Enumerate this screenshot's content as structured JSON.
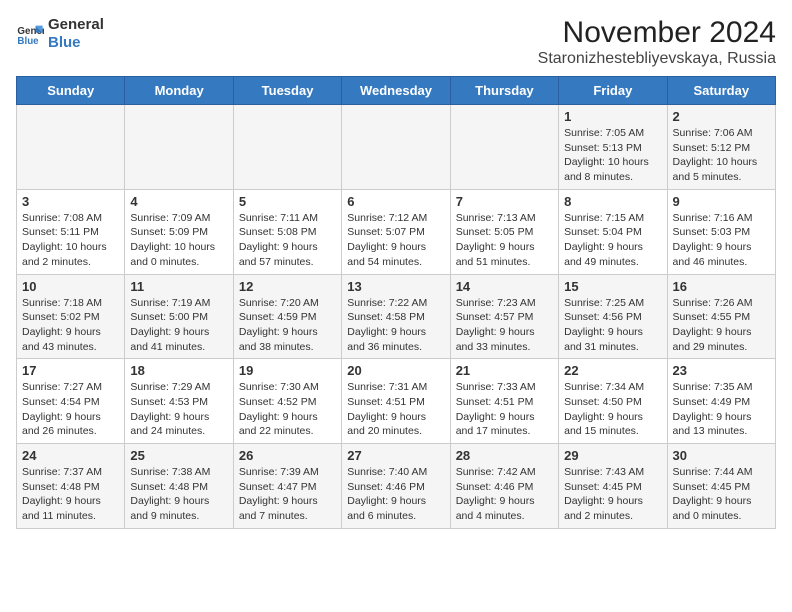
{
  "logo": {
    "general": "General",
    "blue": "Blue"
  },
  "title": "November 2024",
  "subtitle": "Staronizhestebliyevskaya, Russia",
  "days_of_week": [
    "Sunday",
    "Monday",
    "Tuesday",
    "Wednesday",
    "Thursday",
    "Friday",
    "Saturday"
  ],
  "weeks": [
    [
      {
        "day": "",
        "info": ""
      },
      {
        "day": "",
        "info": ""
      },
      {
        "day": "",
        "info": ""
      },
      {
        "day": "",
        "info": ""
      },
      {
        "day": "",
        "info": ""
      },
      {
        "day": "1",
        "info": "Sunrise: 7:05 AM\nSunset: 5:13 PM\nDaylight: 10 hours and 8 minutes."
      },
      {
        "day": "2",
        "info": "Sunrise: 7:06 AM\nSunset: 5:12 PM\nDaylight: 10 hours and 5 minutes."
      }
    ],
    [
      {
        "day": "3",
        "info": "Sunrise: 7:08 AM\nSunset: 5:11 PM\nDaylight: 10 hours and 2 minutes."
      },
      {
        "day": "4",
        "info": "Sunrise: 7:09 AM\nSunset: 5:09 PM\nDaylight: 10 hours and 0 minutes."
      },
      {
        "day": "5",
        "info": "Sunrise: 7:11 AM\nSunset: 5:08 PM\nDaylight: 9 hours and 57 minutes."
      },
      {
        "day": "6",
        "info": "Sunrise: 7:12 AM\nSunset: 5:07 PM\nDaylight: 9 hours and 54 minutes."
      },
      {
        "day": "7",
        "info": "Sunrise: 7:13 AM\nSunset: 5:05 PM\nDaylight: 9 hours and 51 minutes."
      },
      {
        "day": "8",
        "info": "Sunrise: 7:15 AM\nSunset: 5:04 PM\nDaylight: 9 hours and 49 minutes."
      },
      {
        "day": "9",
        "info": "Sunrise: 7:16 AM\nSunset: 5:03 PM\nDaylight: 9 hours and 46 minutes."
      }
    ],
    [
      {
        "day": "10",
        "info": "Sunrise: 7:18 AM\nSunset: 5:02 PM\nDaylight: 9 hours and 43 minutes."
      },
      {
        "day": "11",
        "info": "Sunrise: 7:19 AM\nSunset: 5:00 PM\nDaylight: 9 hours and 41 minutes."
      },
      {
        "day": "12",
        "info": "Sunrise: 7:20 AM\nSunset: 4:59 PM\nDaylight: 9 hours and 38 minutes."
      },
      {
        "day": "13",
        "info": "Sunrise: 7:22 AM\nSunset: 4:58 PM\nDaylight: 9 hours and 36 minutes."
      },
      {
        "day": "14",
        "info": "Sunrise: 7:23 AM\nSunset: 4:57 PM\nDaylight: 9 hours and 33 minutes."
      },
      {
        "day": "15",
        "info": "Sunrise: 7:25 AM\nSunset: 4:56 PM\nDaylight: 9 hours and 31 minutes."
      },
      {
        "day": "16",
        "info": "Sunrise: 7:26 AM\nSunset: 4:55 PM\nDaylight: 9 hours and 29 minutes."
      }
    ],
    [
      {
        "day": "17",
        "info": "Sunrise: 7:27 AM\nSunset: 4:54 PM\nDaylight: 9 hours and 26 minutes."
      },
      {
        "day": "18",
        "info": "Sunrise: 7:29 AM\nSunset: 4:53 PM\nDaylight: 9 hours and 24 minutes."
      },
      {
        "day": "19",
        "info": "Sunrise: 7:30 AM\nSunset: 4:52 PM\nDaylight: 9 hours and 22 minutes."
      },
      {
        "day": "20",
        "info": "Sunrise: 7:31 AM\nSunset: 4:51 PM\nDaylight: 9 hours and 20 minutes."
      },
      {
        "day": "21",
        "info": "Sunrise: 7:33 AM\nSunset: 4:51 PM\nDaylight: 9 hours and 17 minutes."
      },
      {
        "day": "22",
        "info": "Sunrise: 7:34 AM\nSunset: 4:50 PM\nDaylight: 9 hours and 15 minutes."
      },
      {
        "day": "23",
        "info": "Sunrise: 7:35 AM\nSunset: 4:49 PM\nDaylight: 9 hours and 13 minutes."
      }
    ],
    [
      {
        "day": "24",
        "info": "Sunrise: 7:37 AM\nSunset: 4:48 PM\nDaylight: 9 hours and 11 minutes."
      },
      {
        "day": "25",
        "info": "Sunrise: 7:38 AM\nSunset: 4:48 PM\nDaylight: 9 hours and 9 minutes."
      },
      {
        "day": "26",
        "info": "Sunrise: 7:39 AM\nSunset: 4:47 PM\nDaylight: 9 hours and 7 minutes."
      },
      {
        "day": "27",
        "info": "Sunrise: 7:40 AM\nSunset: 4:46 PM\nDaylight: 9 hours and 6 minutes."
      },
      {
        "day": "28",
        "info": "Sunrise: 7:42 AM\nSunset: 4:46 PM\nDaylight: 9 hours and 4 minutes."
      },
      {
        "day": "29",
        "info": "Sunrise: 7:43 AM\nSunset: 4:45 PM\nDaylight: 9 hours and 2 minutes."
      },
      {
        "day": "30",
        "info": "Sunrise: 7:44 AM\nSunset: 4:45 PM\nDaylight: 9 hours and 0 minutes."
      }
    ]
  ]
}
